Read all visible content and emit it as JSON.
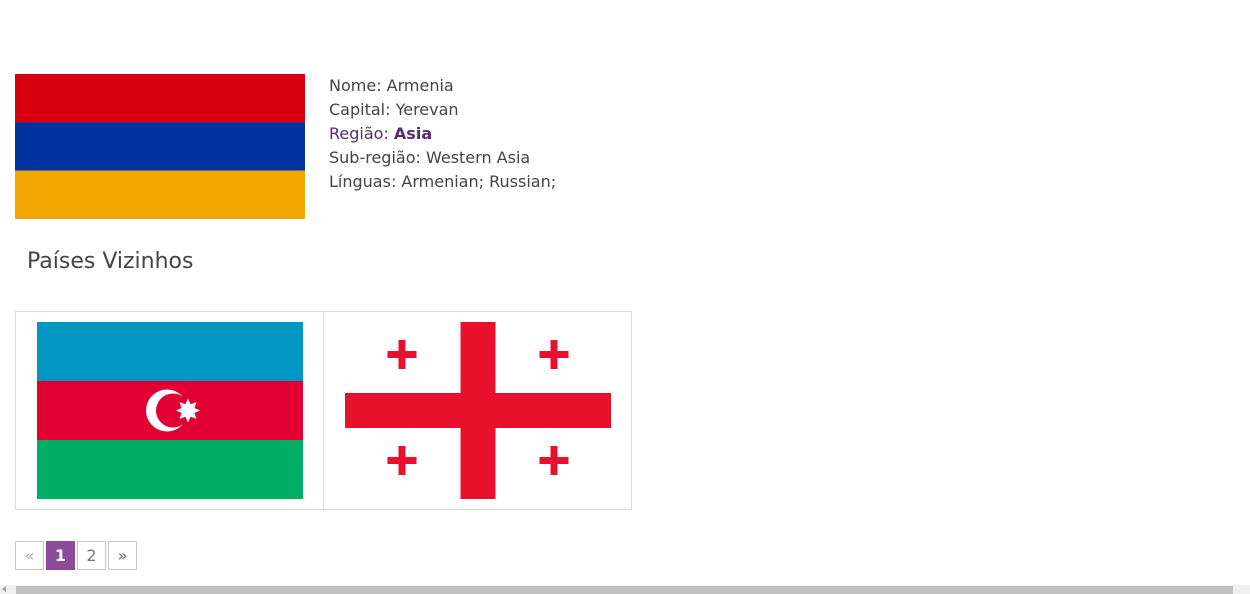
{
  "country": {
    "flag_icon": "armenia-flag",
    "flag_colors": [
      "#d90012",
      "#0033a0",
      "#f2a800"
    ],
    "fields": [
      {
        "label": "Nome: ",
        "value": "Armenia"
      },
      {
        "label": "Capital: ",
        "value": "Yerevan"
      },
      {
        "label": "Região: ",
        "value": "Asia"
      },
      {
        "label": "Sub-região: ",
        "value": "Western Asia"
      },
      {
        "label": "Línguas: ",
        "value": "Armenian; Russian;"
      }
    ]
  },
  "neighbours": {
    "title": "Países Vizinhos",
    "items": [
      {
        "flag_icon": "azerbaijan-flag"
      },
      {
        "flag_icon": "georgia-flag"
      }
    ]
  },
  "pagination": {
    "prev": "«",
    "pages": [
      "1",
      "2"
    ],
    "active": "1",
    "next": "»"
  },
  "colors": {
    "accent": "#8e4a9a",
    "region_link": "#5a2a6e",
    "text": "#444444"
  }
}
